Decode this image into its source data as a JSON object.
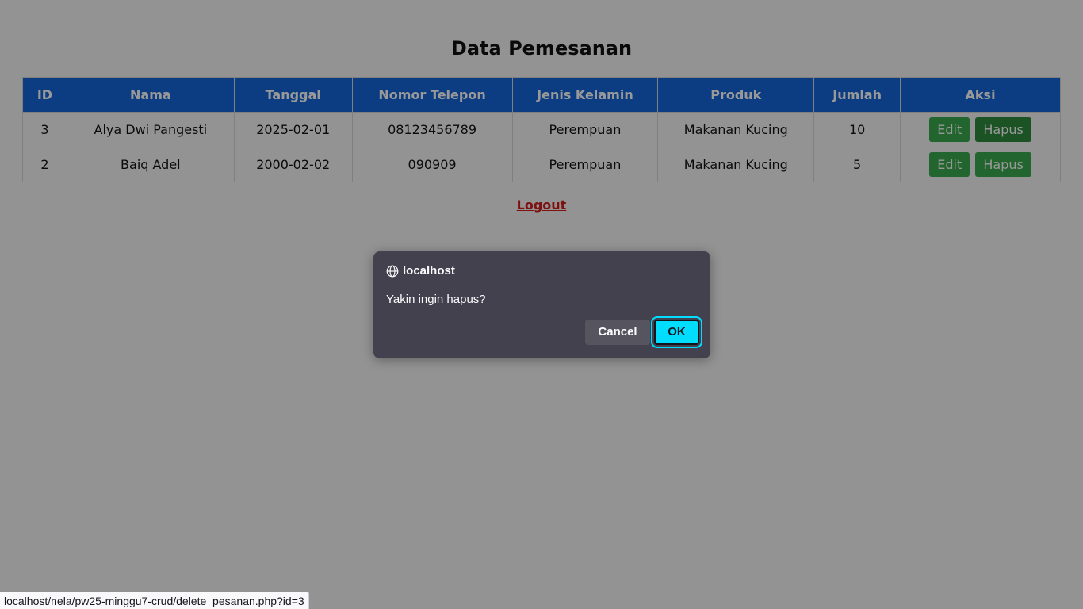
{
  "page": {
    "title": "Data Pemesanan",
    "logout_label": "Logout"
  },
  "table": {
    "headers": [
      "ID",
      "Nama",
      "Tanggal",
      "Nomor Telepon",
      "Jenis Kelamin",
      "Produk",
      "Jumlah",
      "Aksi"
    ],
    "rows": [
      {
        "id": "3",
        "nama": "Alya Dwi Pangesti",
        "tanggal": "2025-02-01",
        "telepon": "08123456789",
        "jenis_kelamin": "Perempuan",
        "produk": "Makanan Kucing",
        "jumlah": "10",
        "edit_label": "Edit",
        "hapus_label": "Hapus"
      },
      {
        "id": "2",
        "nama": "Baiq Adel",
        "tanggal": "2000-02-02",
        "telepon": "090909",
        "jenis_kelamin": "Perempuan",
        "produk": "Makanan Kucing",
        "jumlah": "5",
        "edit_label": "Edit",
        "hapus_label": "Hapus"
      }
    ]
  },
  "dialog": {
    "origin": "localhost",
    "origin_icon": "globe-icon",
    "message": "Yakin ingin hapus?",
    "cancel_label": "Cancel",
    "ok_label": "OK"
  },
  "statusbar": {
    "url": "localhost/nela/pw25-minggu7-crud/delete_pesanan.php?id=3"
  },
  "colors": {
    "header_bg": "#1565d8",
    "button_green": "#3aa84e",
    "logout_red": "#d21c1c",
    "dialog_bg": "#42414d",
    "ok_accent": "#00ddff"
  }
}
